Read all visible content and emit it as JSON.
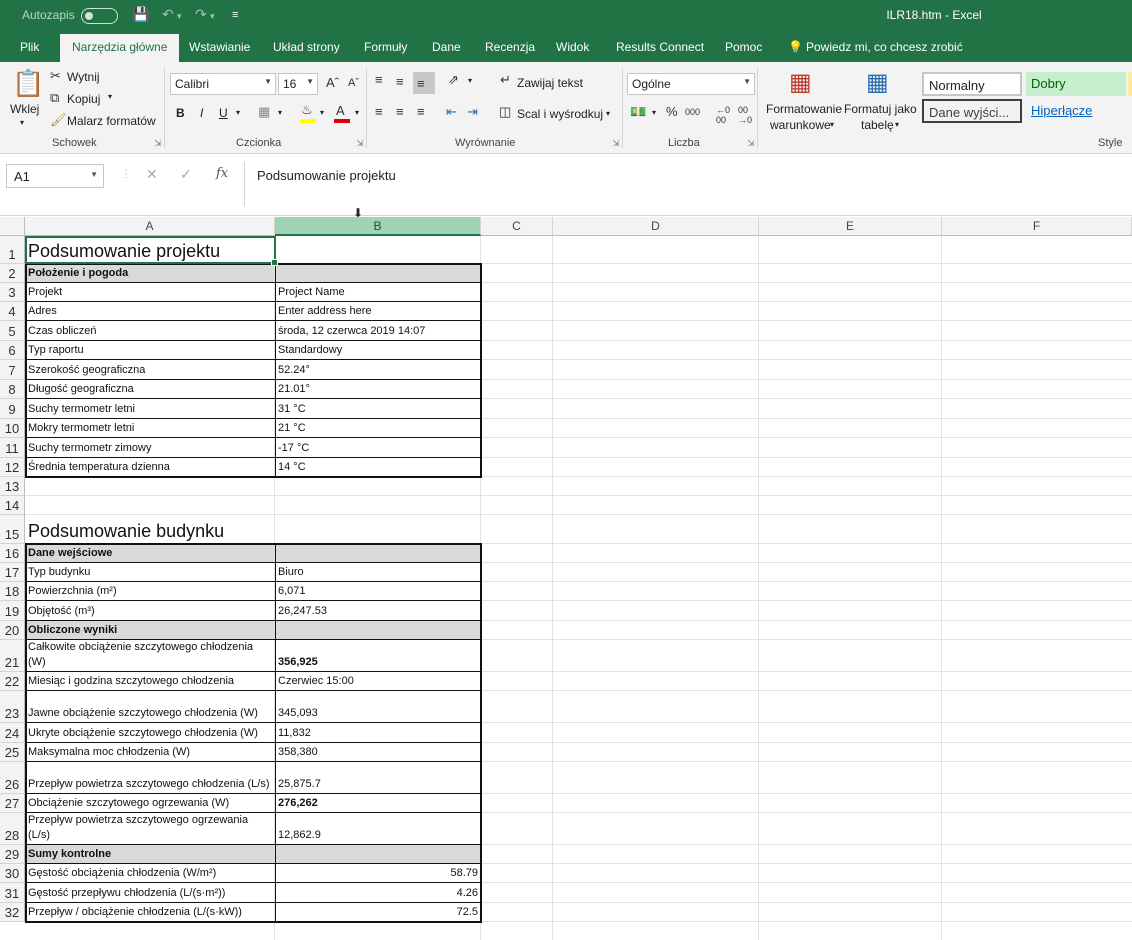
{
  "titlebar": {
    "autosave_label": "Autozapis",
    "save_icon": "save-icon",
    "undo_icon": "undo-icon",
    "redo_icon": "redo-icon",
    "title": "ILR18.htm  -  Excel"
  },
  "tabs": [
    "Plik",
    "Narzędzia główne",
    "Wstawianie",
    "Układ strony",
    "Formuły",
    "Dane",
    "Recenzja",
    "Widok",
    "Results Connect",
    "Pomoc"
  ],
  "tell_me": "Powiedz mi, co chcesz zrobić",
  "ribbon": {
    "clipboard": {
      "paste": "Wklej",
      "cut": "Wytnij",
      "copy": "Kopiuj",
      "format_painter": "Malarz formatów",
      "group": "Schowek"
    },
    "font": {
      "name": "Calibri",
      "size": "16",
      "bold": "B",
      "italic": "I",
      "underline": "U",
      "group": "Czcionka"
    },
    "alignment": {
      "wrap": "Zawijaj tekst",
      "merge": "Scal i wyśrodkuj",
      "group": "Wyrównanie"
    },
    "number": {
      "format": "Ogólne",
      "group": "Liczba"
    },
    "styles": {
      "conditional": "Formatowanie warunkowe",
      "conditional_l1": "Formatowanie",
      "conditional_l2": "warunkowe",
      "format_table_l1": "Formatuj jako",
      "format_table_l2": "tabelę",
      "normal": "Normalny",
      "good": "Dobry",
      "output": "Dane wyjści...",
      "hyperlink": "Hiperłącze",
      "group": "Style"
    }
  },
  "formula_bar": {
    "name_box": "A1",
    "content": "Podsumowanie projektu"
  },
  "columns": [
    "A",
    "B",
    "C",
    "D",
    "E",
    "F"
  ],
  "rows": [
    {
      "n": "1",
      "a": "Podsumowanie projektu",
      "b": ""
    },
    {
      "n": "2",
      "a": "Położenie i pogoda",
      "b": ""
    },
    {
      "n": "3",
      "a": "Projekt",
      "b": "Project Name"
    },
    {
      "n": "4",
      "a": "Adres",
      "b": "Enter address here"
    },
    {
      "n": "5",
      "a": "Czas obliczeń",
      "b": "środa, 12 czerwca 2019 14:07"
    },
    {
      "n": "6",
      "a": "Typ raportu",
      "b": "Standardowy"
    },
    {
      "n": "7",
      "a": "Szerokość geograficzna",
      "b": "52.24°"
    },
    {
      "n": "8",
      "a": "Długość geograficzna",
      "b": "21.01°"
    },
    {
      "n": "9",
      "a": "Suchy termometr letni",
      "b": "31 °C"
    },
    {
      "n": "10",
      "a": "Mokry termometr letni",
      "b": "21 °C"
    },
    {
      "n": "11",
      "a": "Suchy termometr zimowy",
      "b": "-17 °C"
    },
    {
      "n": "12",
      "a": "Średnia temperatura dzienna",
      "b": "14 °C"
    },
    {
      "n": "13",
      "a": "",
      "b": ""
    },
    {
      "n": "14",
      "a": "",
      "b": ""
    },
    {
      "n": "15",
      "a": "Podsumowanie budynku",
      "b": ""
    },
    {
      "n": "16",
      "a": "Dane wejściowe",
      "b": ""
    },
    {
      "n": "17",
      "a": "Typ budynku",
      "b": "Biuro"
    },
    {
      "n": "18",
      "a": "Powierzchnia (m²)",
      "b": "6,071"
    },
    {
      "n": "19",
      "a": "Objętość (m³)",
      "b": "26,247.53"
    },
    {
      "n": "20",
      "a": "Obliczone wyniki",
      "b": ""
    },
    {
      "n": "21",
      "a": "Całkowite obciążenie szczytowego chłodzenia (W)",
      "b": "356,925"
    },
    {
      "n": "22",
      "a": "Miesiąc i godzina szczytowego chłodzenia",
      "b": "Czerwiec 15:00"
    },
    {
      "n": "23",
      "a": "Jawne obciążenie szczytowego chłodzenia (W)",
      "b": "345,093"
    },
    {
      "n": "24",
      "a": "Ukryte obciążenie szczytowego chłodzenia (W)",
      "b": "11,832"
    },
    {
      "n": "25",
      "a": "Maksymalna moc chłodzenia (W)",
      "b": "358,380"
    },
    {
      "n": "26",
      "a": "Przepływ powietrza szczytowego chłodzenia (L/s)",
      "b": "25,875.7"
    },
    {
      "n": "27",
      "a": "Obciążenie szczytowego ogrzewania (W)",
      "b": "276,262"
    },
    {
      "n": "28",
      "a": "Przepływ powietrza szczytowego ogrzewania (L/s)",
      "b": "12,862.9"
    },
    {
      "n": "29",
      "a": "Sumy kontrolne",
      "b": ""
    },
    {
      "n": "30",
      "a": "Gęstość obciążenia chłodzenia (W/m²)",
      "b": "58.79"
    },
    {
      "n": "31",
      "a": "Gęstość przepływu chłodzenia (L/(s·m²))",
      "b": "4.26"
    },
    {
      "n": "32",
      "a": "Przepływ / obciążenie chłodzenia (L/(s·kW))",
      "b": "72.5"
    }
  ]
}
